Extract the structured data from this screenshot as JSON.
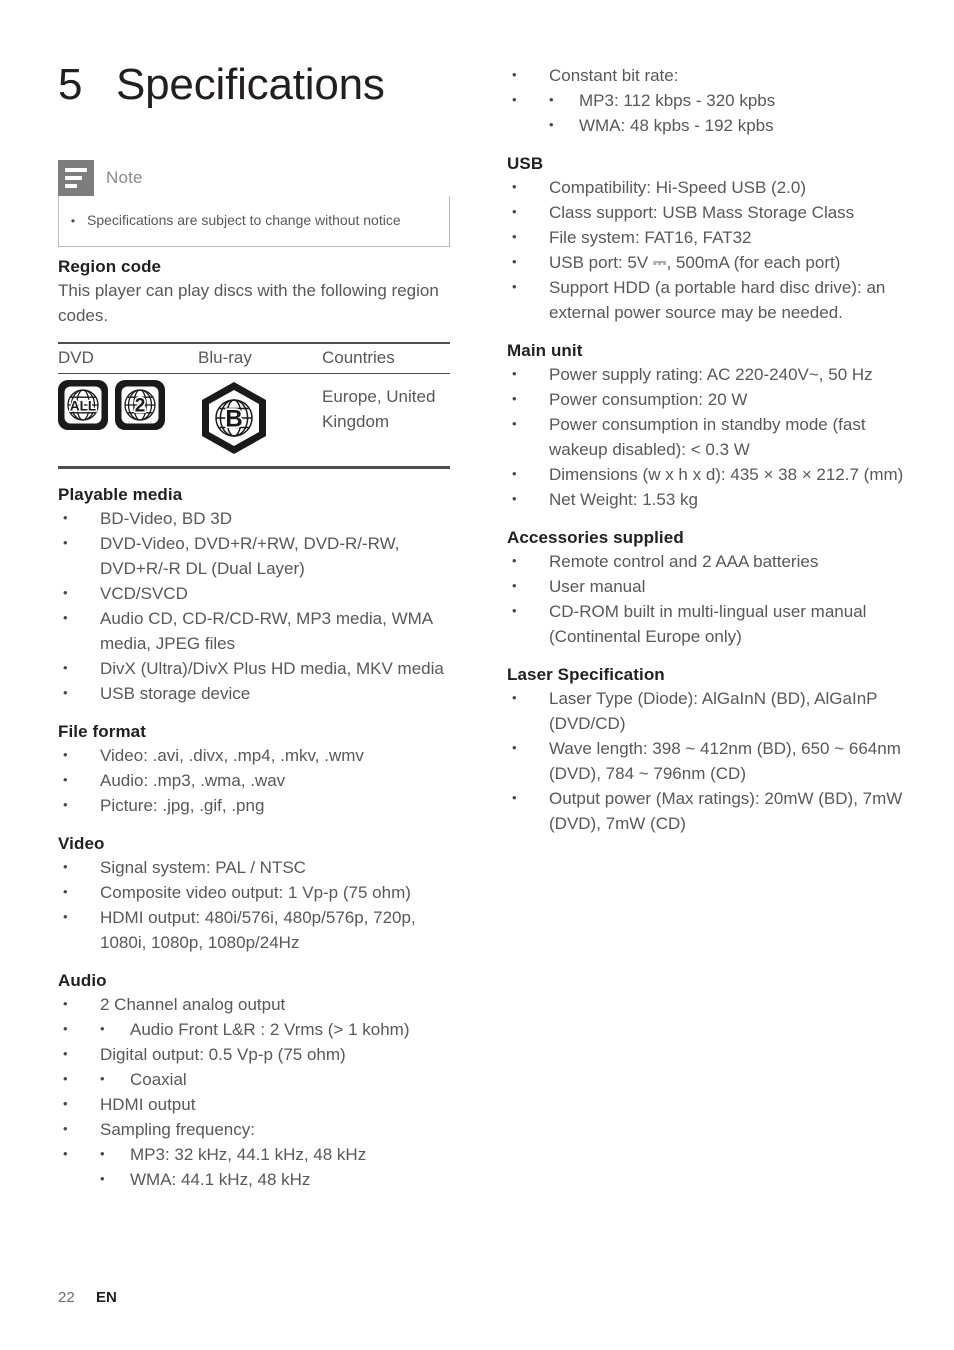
{
  "chapter": {
    "number": "5",
    "title": "Specifications"
  },
  "note": {
    "label": "Note",
    "icon": "note-lines-icon",
    "items": [
      "Specifications are subject to change without notice"
    ]
  },
  "region_code": {
    "heading": "Region code",
    "intro": "This player can play discs with the following region codes.",
    "table": {
      "columns": [
        "DVD",
        "Blu-ray",
        "Countries"
      ],
      "row": {
        "dvd_icons": [
          "ALL",
          "2"
        ],
        "bluray_icon": "B",
        "countries": "Europe, United Kingdom"
      }
    }
  },
  "left_sections": [
    {
      "heading": "Playable media",
      "items": [
        "BD-Video, BD 3D",
        "DVD-Video, DVD+R/+RW, DVD-R/-RW, DVD+R/-R DL (Dual Layer)",
        "VCD/SVCD",
        "Audio CD, CD-R/CD-RW, MP3 media, WMA media, JPEG files",
        "DivX (Ultra)/DivX Plus HD media, MKV media",
        "USB storage device"
      ]
    },
    {
      "heading": "File format",
      "items": [
        "Video: .avi, .divx, .mp4, .mkv, .wmv",
        "Audio: .mp3, .wma, .wav",
        "Picture: .jpg, .gif, .png"
      ]
    },
    {
      "heading": "Video",
      "items": [
        "Signal system: PAL / NTSC",
        "Composite video output: 1 Vp-p (75 ohm)",
        "HDMI output: 480i/576i, 480p/576p, 720p, 1080i, 1080p, 1080p/24Hz"
      ]
    }
  ],
  "audio": {
    "heading": "Audio",
    "item1": "2 Channel analog output",
    "item1_sub": [
      "Audio Front L&R : 2 Vrms (> 1 kohm)"
    ],
    "item2": "Digital output: 0.5 Vp-p (75 ohm)",
    "item2_sub": [
      "Coaxial"
    ],
    "item3": "HDMI output",
    "item4": "Sampling frequency:",
    "item4_sub": [
      "MP3: 32 kHz, 44.1 kHz, 48 kHz",
      "WMA: 44.1 kHz, 48 kHz"
    ]
  },
  "bitrate": {
    "item": "Constant bit rate:",
    "sub": [
      "MP3: 112 kbps - 320 kpbs",
      "WMA: 48 kpbs - 192 kpbs"
    ]
  },
  "right_sections": [
    {
      "heading": "USB",
      "items": [
        "Compatibility: Hi-Speed USB (2.0)",
        "Class support: USB Mass Storage Class",
        "File system: FAT16, FAT32",
        "USB port: 5V ⎓, 500mA (for each port)",
        "Support HDD (a portable hard disc drive): an external power source may be needed."
      ]
    },
    {
      "heading": "Main unit",
      "items": [
        "Power supply rating: AC 220-240V~, 50 Hz",
        "Power consumption: 20 W",
        "Power consumption in standby mode (fast wakeup disabled): < 0.3 W",
        "Dimensions (w x h x d): 435 × 38 × 212.7 (mm)",
        "Net Weight: 1.53 kg"
      ]
    },
    {
      "heading": "Accessories supplied",
      "items": [
        "Remote control and 2 AAA batteries",
        "User manual",
        "CD-ROM built in multi-lingual user manual (Continental Europe only)"
      ]
    },
    {
      "heading": "Laser Specification",
      "items": [
        "Laser Type (Diode): AlGaInN (BD), AlGaInP (DVD/CD)",
        "Wave length: 398 ~ 412nm (BD), 650 ~ 664nm (DVD), 784 ~ 796nm (CD)",
        "Output power (Max ratings): 20mW (BD), 7mW (DVD), 7mW (CD)"
      ]
    }
  ],
  "footer": {
    "page_number": "22",
    "language": "EN"
  },
  "colors": {
    "text": "#58585a",
    "heading": "#231f20",
    "note_icon_bg": "#7d7d7d",
    "rule": "#4d4d4d"
  }
}
